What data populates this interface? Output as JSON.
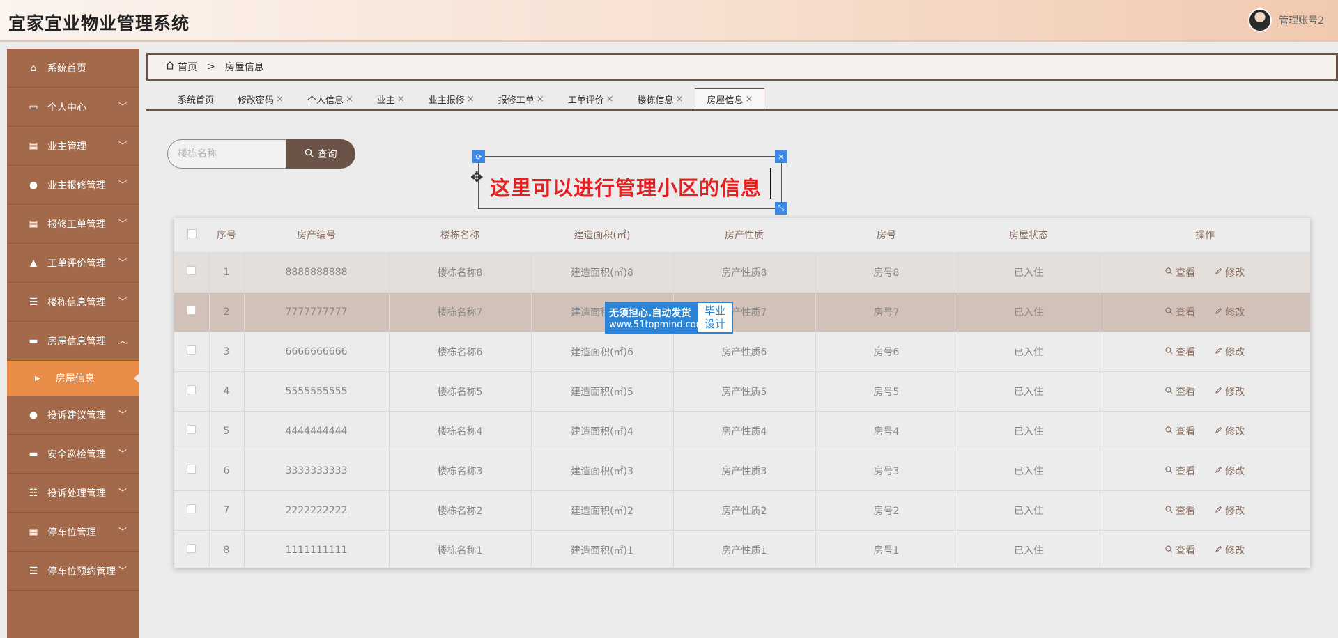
{
  "header": {
    "app_title": "宜家宜业物业管理系统",
    "user_name": "管理账号2"
  },
  "sidebar": {
    "items": [
      {
        "label": "系统首页",
        "icon": "home-icon",
        "chevron": ""
      },
      {
        "label": "个人中心",
        "icon": "card-icon",
        "chevron": "﹀"
      },
      {
        "label": "业主管理",
        "icon": "grid-icon",
        "chevron": "﹀"
      },
      {
        "label": "业主报修管理",
        "icon": "user-icon",
        "chevron": "﹀"
      },
      {
        "label": "报修工单管理",
        "icon": "grid-icon",
        "chevron": "﹀"
      },
      {
        "label": "工单评价管理",
        "icon": "bldg-icon",
        "chevron": "﹀"
      },
      {
        "label": "楼栋信息管理",
        "icon": "list-icon",
        "chevron": "﹀"
      },
      {
        "label": "房屋信息管理",
        "icon": "ticket-icon",
        "chevron": "︿"
      }
    ],
    "sub_item": {
      "label": "房屋信息"
    },
    "items_after": [
      {
        "label": "投诉建议管理",
        "icon": "user-icon",
        "chevron": "﹀"
      },
      {
        "label": "安全巡检管理",
        "icon": "monitor-icon",
        "chevron": "﹀"
      },
      {
        "label": "投诉处理管理",
        "icon": "sliders-icon",
        "chevron": "﹀"
      },
      {
        "label": "停车位管理",
        "icon": "grid-icon",
        "chevron": "﹀"
      },
      {
        "label": "停车位预约管理",
        "icon": "list-icon",
        "chevron": "﹀"
      }
    ]
  },
  "breadcrumb": {
    "home": "首页",
    "separator": ">",
    "current": "房屋信息"
  },
  "tabs": [
    {
      "label": "系统首页",
      "closable": false
    },
    {
      "label": "修改密码",
      "closable": true
    },
    {
      "label": "个人信息",
      "closable": true
    },
    {
      "label": "业主",
      "closable": true
    },
    {
      "label": "业主报修",
      "closable": true
    },
    {
      "label": "报修工单",
      "closable": true
    },
    {
      "label": "工单评价",
      "closable": true
    },
    {
      "label": "楼栋信息",
      "closable": true
    },
    {
      "label": "房屋信息",
      "closable": true,
      "active": true
    }
  ],
  "search": {
    "placeholder": "楼栋名称",
    "button_label": "查询"
  },
  "annotation": {
    "text": "这里可以进行管理小区的信息"
  },
  "table": {
    "columns": [
      "序号",
      "房产编号",
      "楼栋名称",
      "建造面积(㎡)",
      "房产性质",
      "房号",
      "房屋状态",
      "操作"
    ],
    "rows": [
      [
        "1",
        "8888888888",
        "楼栋名称8",
        "建造面积(㎡)8",
        "房产性质8",
        "房号8",
        "已入住"
      ],
      [
        "2",
        "7777777777",
        "楼栋名称7",
        "建造面积(㎡)7",
        "房产性质7",
        "房号7",
        "已入住"
      ],
      [
        "3",
        "6666666666",
        "楼栋名称6",
        "建造面积(㎡)6",
        "房产性质6",
        "房号6",
        "已入住"
      ],
      [
        "4",
        "5555555555",
        "楼栋名称5",
        "建造面积(㎡)5",
        "房产性质5",
        "房号5",
        "已入住"
      ],
      [
        "5",
        "4444444444",
        "楼栋名称4",
        "建造面积(㎡)4",
        "房产性质4",
        "房号4",
        "已入住"
      ],
      [
        "6",
        "3333333333",
        "楼栋名称3",
        "建造面积(㎡)3",
        "房产性质3",
        "房号3",
        "已入住"
      ],
      [
        "7",
        "2222222222",
        "楼栋名称2",
        "建造面积(㎡)2",
        "房产性质2",
        "房号2",
        "已入住"
      ],
      [
        "8",
        "1111111111",
        "楼栋名称1",
        "建造面积(㎡)1",
        "房产性质1",
        "房号1",
        "已入住"
      ]
    ],
    "action_view": "查看",
    "action_edit": "修改"
  },
  "watermark": {
    "line1": "无须担心.自动发货",
    "line2": "www.51topmind.com",
    "badge_top": "毕业",
    "badge_bottom": "设计"
  },
  "colors": {
    "sidebar": "#a2694a",
    "active_sub": "#e98c48",
    "accent_dark": "#6b5347",
    "annotation_red": "#e62020"
  }
}
